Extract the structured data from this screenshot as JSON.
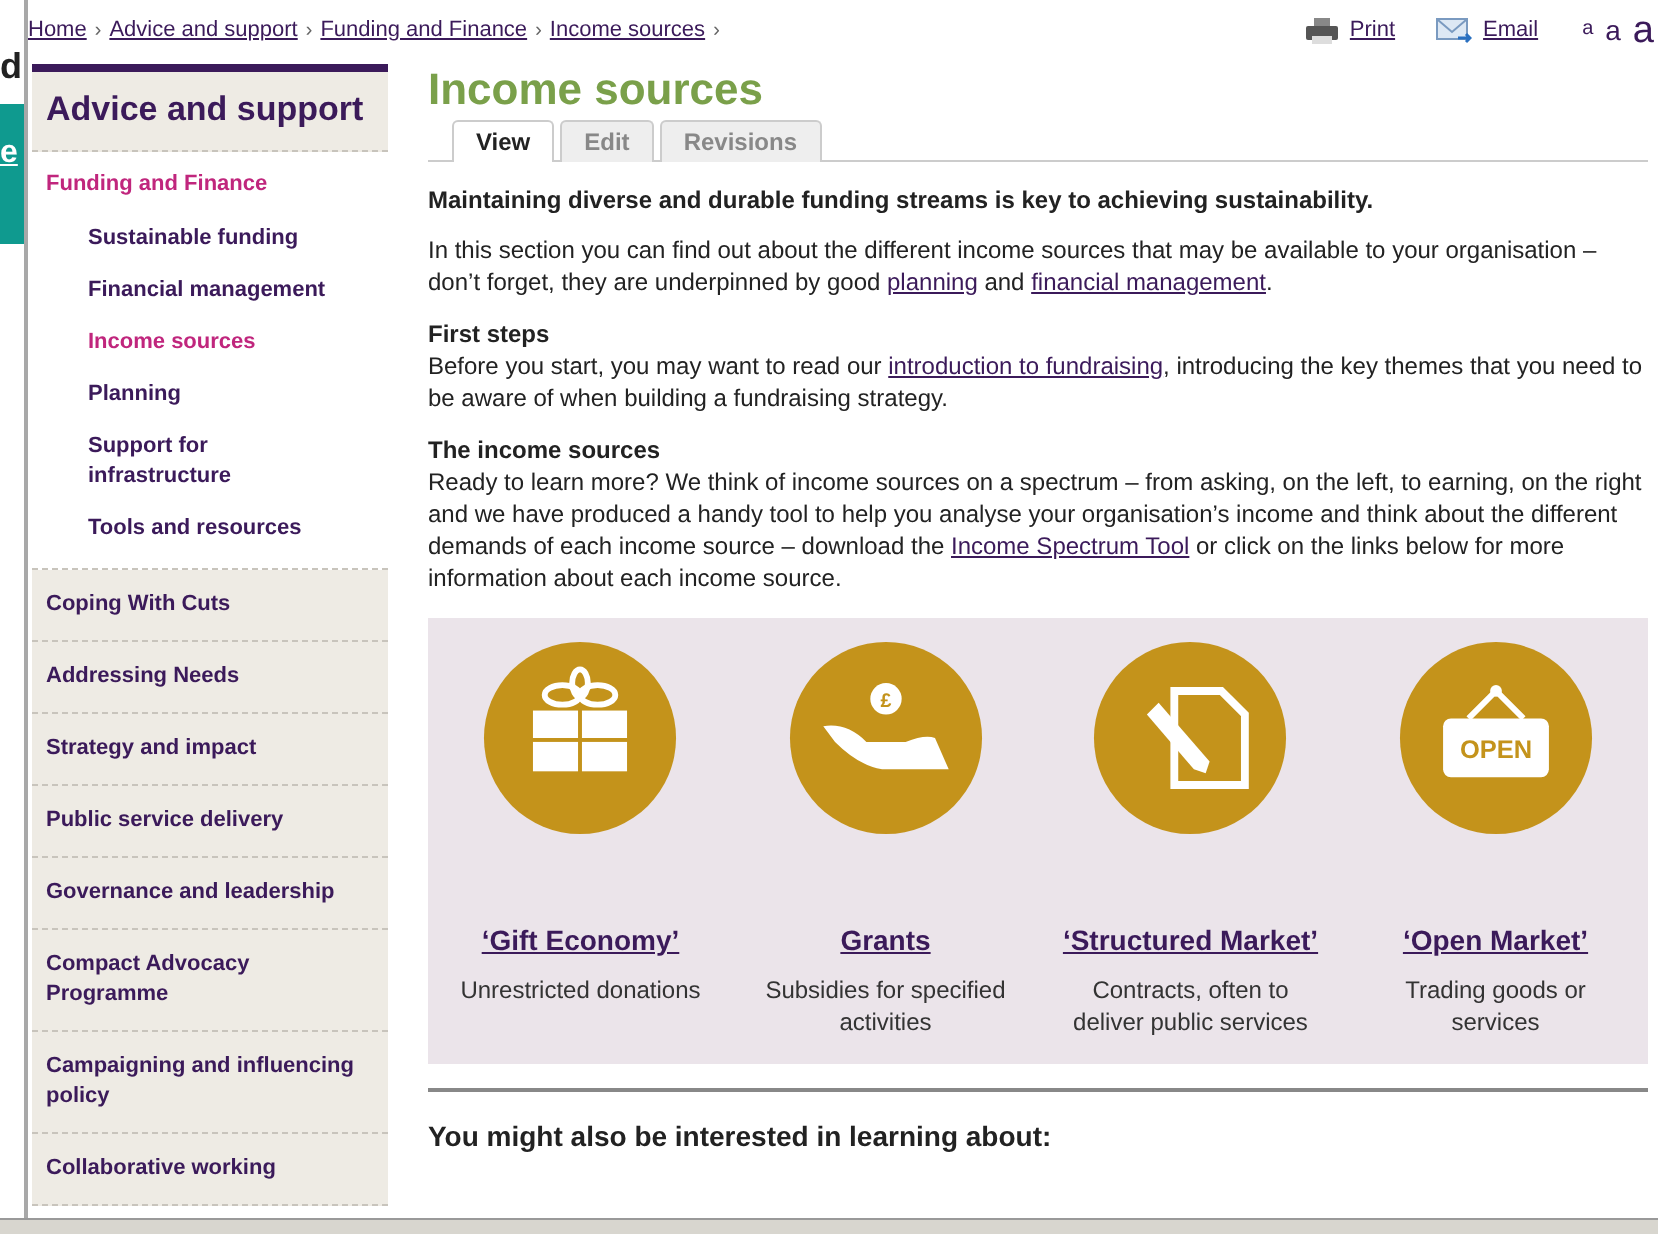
{
  "edge_window": {
    "letter": "d",
    "button_text": "e"
  },
  "breadcrumb": {
    "separator": "›",
    "items": [
      "Home",
      "Advice and support",
      "Funding and Finance",
      "Income sources"
    ]
  },
  "tools": {
    "print": "Print",
    "email": "Email",
    "text_sizes": [
      "a",
      "a",
      "a"
    ]
  },
  "sidebar": {
    "heading": "Advice and support",
    "items": [
      {
        "label": "Funding and Finance",
        "selected": true,
        "children": [
          {
            "label": "Sustainable funding",
            "selected": false
          },
          {
            "label": "Financial management",
            "selected": false
          },
          {
            "label": "Income sources",
            "selected": true
          },
          {
            "label": "Planning",
            "selected": false
          },
          {
            "label": "Support for infrastructure",
            "selected": false
          },
          {
            "label": "Tools and resources",
            "selected": false
          }
        ]
      },
      {
        "label": "Coping With Cuts",
        "selected": false
      },
      {
        "label": "Addressing Needs",
        "selected": false
      },
      {
        "label": "Strategy and impact",
        "selected": false
      },
      {
        "label": "Public service delivery",
        "selected": false
      },
      {
        "label": "Governance and leadership",
        "selected": false
      },
      {
        "label": "Compact Advocacy Programme",
        "selected": false
      },
      {
        "label": "Campaigning and influencing policy",
        "selected": false
      },
      {
        "label": "Collaborative working",
        "selected": false
      }
    ]
  },
  "page": {
    "title": "Income sources",
    "tabs": [
      {
        "label": "View",
        "selected": true
      },
      {
        "label": "Edit",
        "selected": false
      },
      {
        "label": "Revisions",
        "selected": false
      }
    ],
    "lead": "Maintaining diverse and durable funding streams is key to achieving sustainability.",
    "sections": [
      {
        "parts": [
          {
            "kind": "text",
            "text": "In this section you can find out about the different income sources that may be available to your organisation – don’t forget, they are underpinned by good "
          },
          {
            "kind": "link",
            "text": "planning"
          },
          {
            "kind": "text",
            "text": " and "
          },
          {
            "kind": "link",
            "text": "financial management"
          },
          {
            "kind": "text",
            "text": "."
          }
        ]
      },
      {
        "heading": "First steps",
        "parts": [
          {
            "kind": "text",
            "text": "Before you start, you may want to read our "
          },
          {
            "kind": "link",
            "text": "introduction to fundraising"
          },
          {
            "kind": "text",
            "text": ", introducing the key themes that you need to be aware of when building a fundraising strategy."
          }
        ]
      },
      {
        "heading": "The income sources",
        "parts": [
          {
            "kind": "text",
            "text": "Ready to learn more? We think of income sources on a spectrum – from asking, on the left, to earning, on the right and we have produced a handy tool to help you analyse your organisation’s income and think about the different demands of each income source – download the "
          },
          {
            "kind": "link",
            "text": "Income Spectrum Tool"
          },
          {
            "kind": "text",
            "text": " or click on the links below for more information about each income source."
          }
        ]
      }
    ],
    "sources": [
      {
        "kind": "gift",
        "title": "‘Gift Economy’",
        "description": "Unrestricted donations"
      },
      {
        "kind": "hand",
        "title": "Grants",
        "description": "Subsidies for specified activities",
        "icon_text": "£"
      },
      {
        "kind": "document",
        "title": "‘Structured Market’",
        "description": "Contracts, often to deliver public services"
      },
      {
        "kind": "sign",
        "title": "‘Open Market’",
        "description": "Trading goods or services",
        "icon_text": "OPEN"
      }
    ],
    "related_heading": "You might also be interested in learning about:"
  }
}
